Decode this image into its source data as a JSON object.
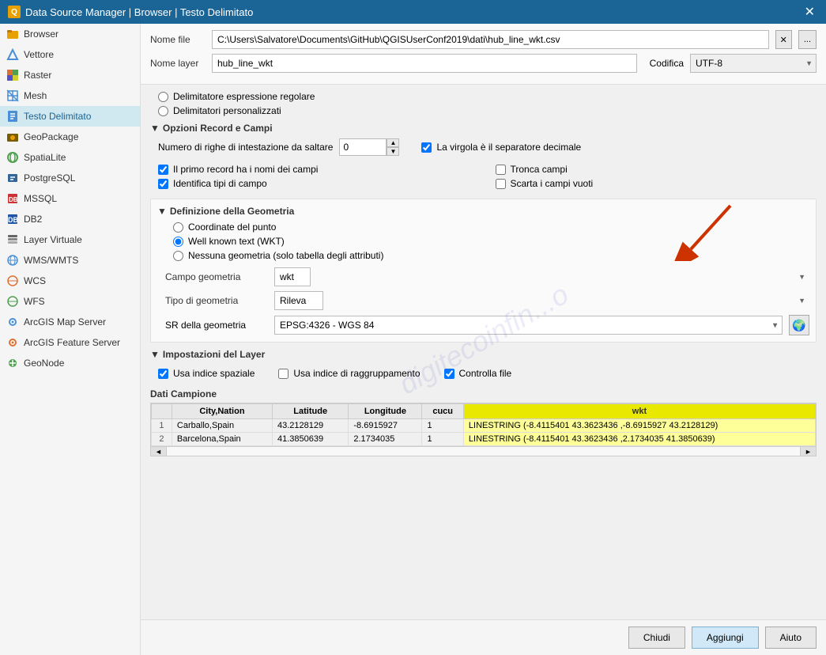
{
  "titleBar": {
    "icon": "Q",
    "title": "Data Source Manager | Browser | Testo Delimitato",
    "closeLabel": "✕"
  },
  "sidebar": {
    "items": [
      {
        "id": "browser",
        "label": "Browser",
        "icon": "folder",
        "active": false
      },
      {
        "id": "vettore",
        "label": "Vettore",
        "icon": "vector",
        "active": false
      },
      {
        "id": "raster",
        "label": "Raster",
        "icon": "raster",
        "active": false
      },
      {
        "id": "mesh",
        "label": "Mesh",
        "icon": "mesh",
        "active": false
      },
      {
        "id": "testo-delimitato",
        "label": "Testo Delimitato",
        "icon": "csv",
        "active": true
      },
      {
        "id": "geopackage",
        "label": "GeoPackage",
        "icon": "geo",
        "active": false
      },
      {
        "id": "spatialite",
        "label": "SpatiaLite",
        "icon": "spatia",
        "active": false
      },
      {
        "id": "postgresql",
        "label": "PostgreSQL",
        "icon": "pg",
        "active": false
      },
      {
        "id": "mssql",
        "label": "MSSQL",
        "icon": "mssql",
        "active": false
      },
      {
        "id": "db2",
        "label": "DB2",
        "icon": "db2",
        "active": false
      },
      {
        "id": "layer-virtuale",
        "label": "Layer Virtuale",
        "icon": "lv",
        "active": false
      },
      {
        "id": "wms-wmts",
        "label": "WMS/WMTS",
        "icon": "wms",
        "active": false
      },
      {
        "id": "wcs",
        "label": "WCS",
        "icon": "wcs",
        "active": false
      },
      {
        "id": "wfs",
        "label": "WFS",
        "icon": "wfs",
        "active": false
      },
      {
        "id": "arcgis-map",
        "label": "ArcGIS Map Server",
        "icon": "arcgis",
        "active": false
      },
      {
        "id": "arcgis-feature",
        "label": "ArcGIS Feature Server",
        "icon": "arcgis2",
        "active": false
      },
      {
        "id": "geonode",
        "label": "GeoNode",
        "icon": "geonode",
        "active": false
      }
    ]
  },
  "topFields": {
    "fileLabel": "Nome file",
    "fileValue": "C:\\Users\\Salvatore\\Documents\\GitHub\\QGISUserConf2019\\dati\\hub_line_wkt.csv",
    "layerLabel": "Nome layer",
    "layerValue": "hub_line_wkt",
    "encodingLabel": "Codifica",
    "encodingValue": "UTF-8",
    "clearBtn": "✕",
    "browseBtn": "..."
  },
  "sections": {
    "recordOptions": {
      "header": "Opzioni Record e Campi",
      "headerExpanded": true,
      "headerTriangle": "▼",
      "numHeaderLabel": "Numero di righe di intestazione da saltare",
      "numHeaderValue": "0",
      "checkboxes": [
        {
          "id": "primo-record",
          "label": "Il primo record ha i nomi dei campi",
          "checked": true
        },
        {
          "id": "identifica-tipi",
          "label": "Identifica tipi di campo",
          "checked": true
        },
        {
          "id": "virgola-sep",
          "label": "La virgola è il separatore decimale",
          "checked": true
        },
        {
          "id": "tronca-campi",
          "label": "Tronca campi",
          "checked": false
        },
        {
          "id": "scarta-vuoti",
          "label": "Scarta i campi vuoti",
          "checked": false
        }
      ]
    },
    "geometriaOptions": {
      "header": "Definizione della Geometria",
      "headerTriangle": "▼",
      "radioOptions": [
        {
          "id": "coord-punto",
          "label": "Coordinate del punto",
          "checked": false
        },
        {
          "id": "wkt",
          "label": "Well known text (WKT)",
          "checked": true
        },
        {
          "id": "nessuna-geo",
          "label": "Nessuna geometria (solo tabella degli attributi)",
          "checked": false
        }
      ],
      "campoGeoLabel": "Campo geometria",
      "campoGeoValue": "wkt",
      "tipoGeoLabel": "Tipo di geometria",
      "tipoGeoValue": "Rileva",
      "srLabel": "SR della geometria",
      "srValue": "EPSG:4326 - WGS 84"
    },
    "layerSettings": {
      "header": "Impostazioni del Layer",
      "headerTriangle": "▼",
      "checkboxes": [
        {
          "id": "usa-indice-spaziale",
          "label": "Usa indice spaziale",
          "checked": true
        },
        {
          "id": "usa-indice-raggruppamento",
          "label": "Usa indice di raggruppamento",
          "checked": false
        },
        {
          "id": "controlla-file",
          "label": "Controlla file",
          "checked": true
        }
      ]
    },
    "datiCampione": {
      "header": "Dati Campione",
      "tableHeaders": [
        "",
        "City,Nation",
        "Latitude",
        "Longitude",
        "cucu",
        "wkt"
      ],
      "tableRows": [
        {
          "rowNum": "1",
          "city": "Carballo,Spain",
          "lat": "43.2128129",
          "lon": "-8.6915927",
          "cucu": "1",
          "wkt": "LINESTRING (-8.4115401 43.3623436 ,-8.6915927 43.2128129)"
        },
        {
          "rowNum": "2",
          "city": "Barcelona,Spain",
          "lat": "41.3850639",
          "lon": "2.1734035",
          "cucu": "1",
          "wkt": "LINESTRING (-8.4115401 43.3623436 ,2.1734035 41.3850639)"
        }
      ]
    }
  },
  "bottomButtons": {
    "chiudi": "Chiudi",
    "aggiungi": "Aggiungi",
    "aiuto": "Aiuto"
  },
  "watermark": "digitecoinfin...o",
  "arrow": {
    "visible": true
  }
}
